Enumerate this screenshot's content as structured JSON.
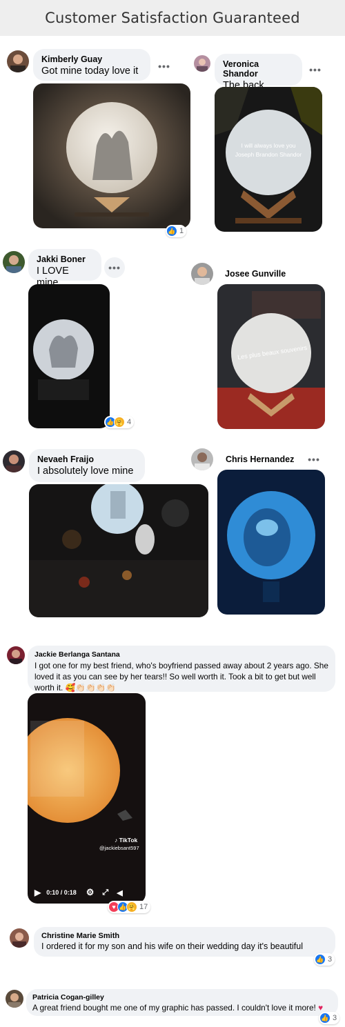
{
  "header": {
    "title": "Customer Satisfaction Guaranteed"
  },
  "icons": {
    "more": "more-options-icon",
    "like": "like-reaction-icon",
    "love": "love-reaction-icon",
    "care": "care-reaction-icon",
    "play": "play-icon",
    "settings": "gear-icon",
    "fullscreen": "fullscreen-icon",
    "volume": "volume-icon",
    "heart": "heart-icon"
  },
  "more_glyph": "•••",
  "comments": {
    "kimberly": {
      "name": "Kimberly Guay",
      "text": "Got mine today love it",
      "reaction_count": "1"
    },
    "veronica": {
      "name": "Veronica Shandor",
      "text": "The back",
      "lamp_text_line1": "I will always love you",
      "lamp_text_line2": "Joseph Brandon Shandor"
    },
    "jakki": {
      "name": "Jakki Boner",
      "text": "I LOVE mine.",
      "reaction_count": "4"
    },
    "josee": {
      "name": "Josee Gunville",
      "lamp_text": "Les plus beaux souvenirs"
    },
    "nevaeh": {
      "name": "Nevaeh Fraijo",
      "text": "I absolutely love mine"
    },
    "chris": {
      "name": "Chris Hernandez"
    },
    "jackie": {
      "name": "Jackie Berlanga Santana",
      "text": "I got one for my best friend, who's boyfriend passed away about 2 years ago. She loved it as you can see by her tears!! So well worth it. Took a bit to get but well worth it. 🥰👏🏻👏🏻👏🏻👏🏻",
      "video_brand": "TikTok",
      "video_handle": "@jackiebsant597",
      "video_time": "0:10 / 0:18",
      "reaction_count": "17"
    },
    "christine": {
      "name": "Christine Marie Smith",
      "text": "I ordered it for my son and his wife on their wedding day it's beautiful",
      "reaction_count": "3"
    },
    "patricia": {
      "name": "Patricia Cogan-gilley",
      "text": "A great friend bought me one of my graphic has passed. I couldn't love it more! ",
      "reaction_count": "3"
    }
  }
}
